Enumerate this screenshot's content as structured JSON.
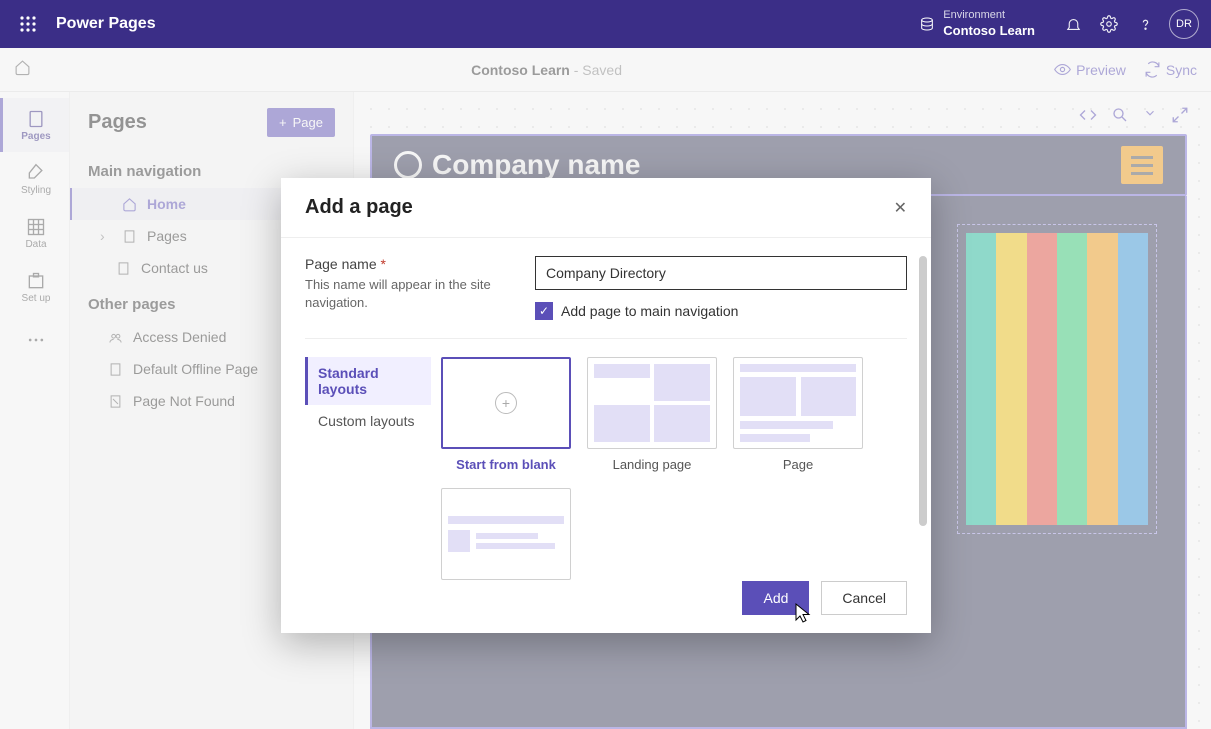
{
  "topbar": {
    "brand": "Power Pages",
    "env_label": "Environment",
    "env_name": "Contoso Learn",
    "avatar": "DR"
  },
  "subbar": {
    "site": "Contoso Learn",
    "saved": " - Saved",
    "preview": "Preview",
    "sync": "Sync"
  },
  "rail": [
    {
      "label": "Pages",
      "active": true
    },
    {
      "label": "Styling",
      "active": false
    },
    {
      "label": "Data",
      "active": false
    },
    {
      "label": "Set up",
      "active": false
    }
  ],
  "sidepanel": {
    "title": "Pages",
    "add_button": "Page",
    "section_main": "Main navigation",
    "main_items": [
      {
        "label": "Home",
        "icon": "home",
        "selected": true
      },
      {
        "label": "Pages",
        "icon": "doc",
        "expandable": true
      },
      {
        "label": "Contact us",
        "icon": "doc"
      }
    ],
    "section_other": "Other pages",
    "other_items": [
      {
        "label": "Access Denied",
        "icon": "lock"
      },
      {
        "label": "Default Offline Page",
        "icon": "doc"
      },
      {
        "label": "Page Not Found",
        "icon": "missing"
      }
    ]
  },
  "canvas": {
    "company": "Company name"
  },
  "modal": {
    "title": "Add a page",
    "name_label": "Page name",
    "hint": "This name will appear in the site navigation.",
    "name_value": "Company Directory",
    "checkbox": "Add page to main navigation",
    "tab_standard": "Standard layouts",
    "tab_custom": "Custom layouts",
    "cards": [
      "Start from blank",
      "Landing page",
      "Page"
    ],
    "add": "Add",
    "cancel": "Cancel"
  }
}
